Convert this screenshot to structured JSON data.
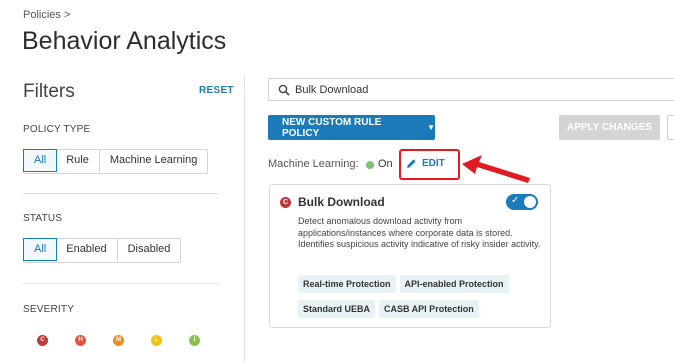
{
  "breadcrumb": "Policies >",
  "page_title": "Behavior Analytics",
  "filters": {
    "title": "Filters",
    "reset": "RESET",
    "policy_type": {
      "label": "POLICY TYPE",
      "options": [
        "All",
        "Rule",
        "Machine Learning"
      ],
      "selected": "All"
    },
    "status": {
      "label": "STATUS",
      "options": [
        "All",
        "Enabled",
        "Disabled"
      ],
      "selected": "All"
    },
    "severity": {
      "label": "SEVERITY",
      "levels": [
        {
          "letter": "C",
          "color": "#c0393a"
        },
        {
          "letter": "H",
          "color": "#e0553e"
        },
        {
          "letter": "M",
          "color": "#f08a24"
        },
        {
          "letter": "L",
          "color": "#f2c21b"
        },
        {
          "letter": "I",
          "color": "#8cc152"
        }
      ]
    }
  },
  "search": {
    "value": "Bulk Download",
    "icon": "search-icon"
  },
  "toolbar": {
    "new_rule": "NEW CUSTOM RULE POLICY",
    "apply": "APPLY CHANGES"
  },
  "machine_learning": {
    "label": "Machine Learning:",
    "status": "On",
    "edit": "EDIT"
  },
  "policy_card": {
    "severity_letter": "C",
    "title": "Bulk Download",
    "enabled": true,
    "description": "Detect anomalous download activity from applications/instances where corporate data is stored. Identifies suspicious activity indicative of risky insider activity.",
    "tags": [
      "Real-time Protection",
      "API-enabled Protection",
      "Standard UEBA",
      "CASB API Protection"
    ]
  },
  "colors": {
    "accent": "#1b7bb8",
    "annotation": "#e01b22",
    "on_dot": "#7cc46b"
  }
}
